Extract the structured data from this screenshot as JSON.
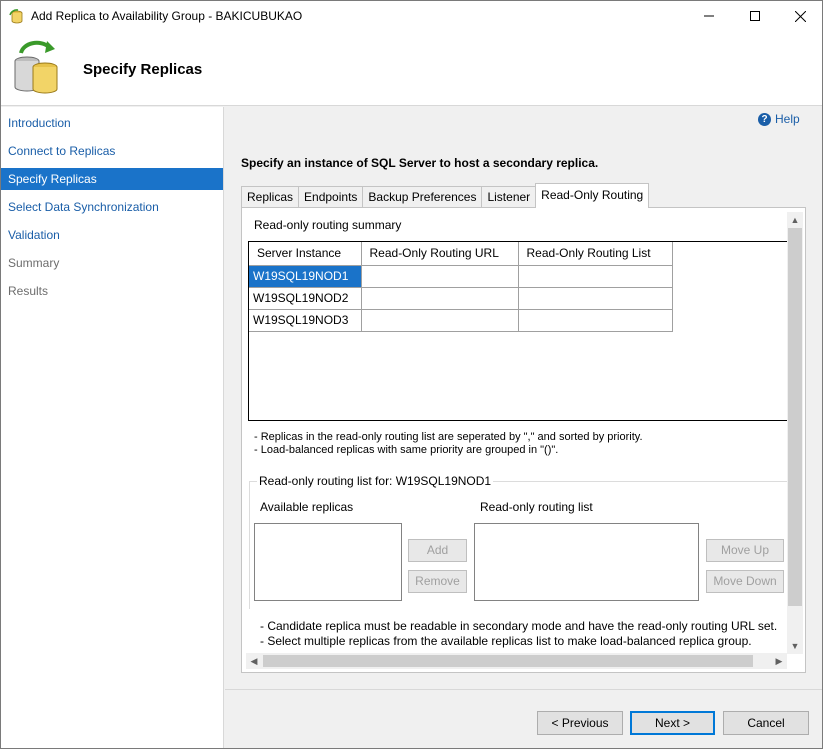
{
  "window": {
    "title": "Add Replica to Availability Group - BAKICUBUKAO"
  },
  "header": {
    "title": "Specify Replicas"
  },
  "nav": {
    "items": [
      {
        "label": "Introduction",
        "state": "link"
      },
      {
        "label": "Connect to Replicas",
        "state": "link"
      },
      {
        "label": "Specify Replicas",
        "state": "active"
      },
      {
        "label": "Select Data Synchronization",
        "state": "link"
      },
      {
        "label": "Validation",
        "state": "link"
      },
      {
        "label": "Summary",
        "state": "disabled"
      },
      {
        "label": "Results",
        "state": "disabled"
      }
    ]
  },
  "help": {
    "label": "Help"
  },
  "main": {
    "instruction": "Specify an instance of SQL Server to host a secondary replica.",
    "tabs": [
      "Replicas",
      "Endpoints",
      "Backup Preferences",
      "Listener",
      "Read-Only Routing"
    ],
    "active_tab": "Read-Only Routing"
  },
  "routing": {
    "summary_label": "Read-only routing summary",
    "columns": [
      "Server Instance",
      "Read-Only Routing URL",
      "Read-Only Routing List"
    ],
    "rows": [
      {
        "server": "W19SQL19NOD1",
        "url": "",
        "list": ""
      },
      {
        "server": "W19SQL19NOD2",
        "url": "",
        "list": ""
      },
      {
        "server": "W19SQL19NOD3",
        "url": "",
        "list": ""
      }
    ],
    "note1": "- Replicas in the read-only routing list are seperated by \",\" and sorted by priority.",
    "note2": "- Load-balanced replicas with same priority are grouped in \"()\".",
    "list_for": "Read-only routing list for: W19SQL19NOD1",
    "available_label": "Available replicas",
    "routing_list_label": "Read-only routing list",
    "add_label": "Add",
    "remove_label": "Remove",
    "move_up_label": "Move Up",
    "move_down_label": "Move Down",
    "note3": "- Candidate replica must be readable in secondary mode and have the read-only routing URL set.",
    "note4": "- Select multiple replicas from the available replicas list to make load-balanced replica group."
  },
  "footer": {
    "previous_label": "< Previous",
    "next_label": "Next >",
    "cancel_label": "Cancel"
  }
}
